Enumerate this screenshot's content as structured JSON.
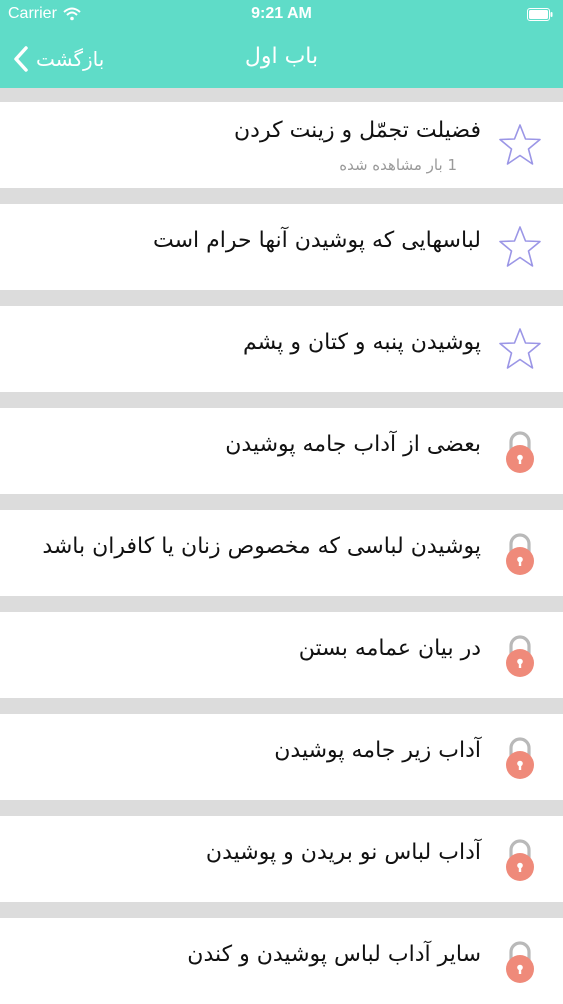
{
  "status_bar": {
    "carrier": "Carrier",
    "time": "9:21 AM"
  },
  "nav": {
    "back_label": "بازگشت",
    "title": "باب اول"
  },
  "colors": {
    "accent": "#5fdcc8",
    "star_outline": "#9b96e6",
    "lock_body": "#ef8a7a",
    "lock_shackle": "#b9b9b9"
  },
  "items": [
    {
      "title": "فضیلت تجمّل و زینت کردن",
      "subtitle": "1 بار مشاهده شده",
      "icon": "star-outline-icon"
    },
    {
      "title": "لباسهایی که پوشیدن آنها حرام است",
      "subtitle": "",
      "icon": "star-outline-icon"
    },
    {
      "title": "پوشیدن پنبه و کتان و پشم",
      "subtitle": "",
      "icon": "star-outline-icon"
    },
    {
      "title": "بعضی از آداب جامه پوشیدن",
      "subtitle": "",
      "icon": "lock-icon"
    },
    {
      "title": "پوشیدن لباسی که مخصوص زنان یا کافران باشد",
      "subtitle": "",
      "icon": "lock-icon"
    },
    {
      "title": "در بیان عمامه بستن",
      "subtitle": "",
      "icon": "lock-icon"
    },
    {
      "title": "آداب زیر جامه پوشیدن",
      "subtitle": "",
      "icon": "lock-icon"
    },
    {
      "title": "آداب لباس نو بریدن و پوشیدن",
      "subtitle": "",
      "icon": "lock-icon"
    },
    {
      "title": "سایر آداب لباس پوشیدن و کندن",
      "subtitle": "",
      "icon": "lock-icon"
    }
  ]
}
